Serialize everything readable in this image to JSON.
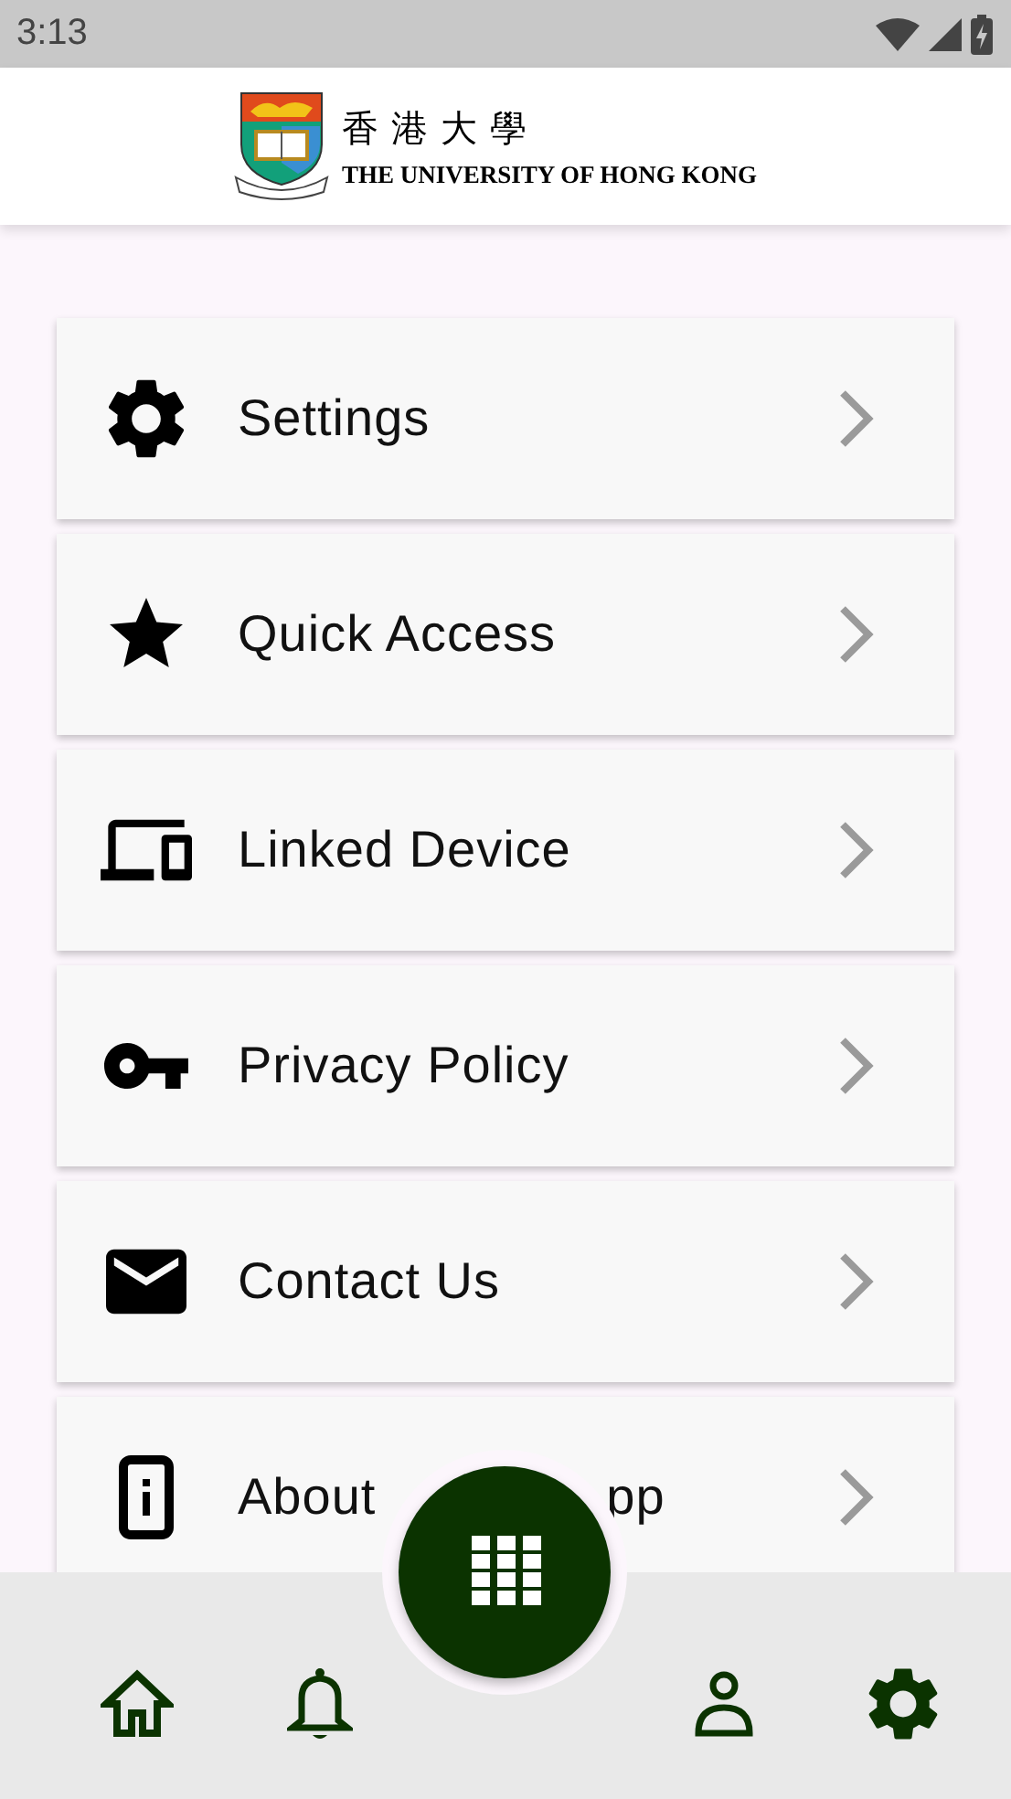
{
  "status_bar": {
    "time": "3:13"
  },
  "header": {
    "name_zh": "香 港 大 學",
    "name_en": "THE UNIVERSITY OF HONG KONG"
  },
  "menu": [
    {
      "label": "Settings"
    },
    {
      "label": "Quick Access"
    },
    {
      "label": "Linked Device"
    },
    {
      "label": "Privacy Policy"
    },
    {
      "label": "Contact Us"
    },
    {
      "label": "About",
      "label_end": "pp"
    }
  ]
}
